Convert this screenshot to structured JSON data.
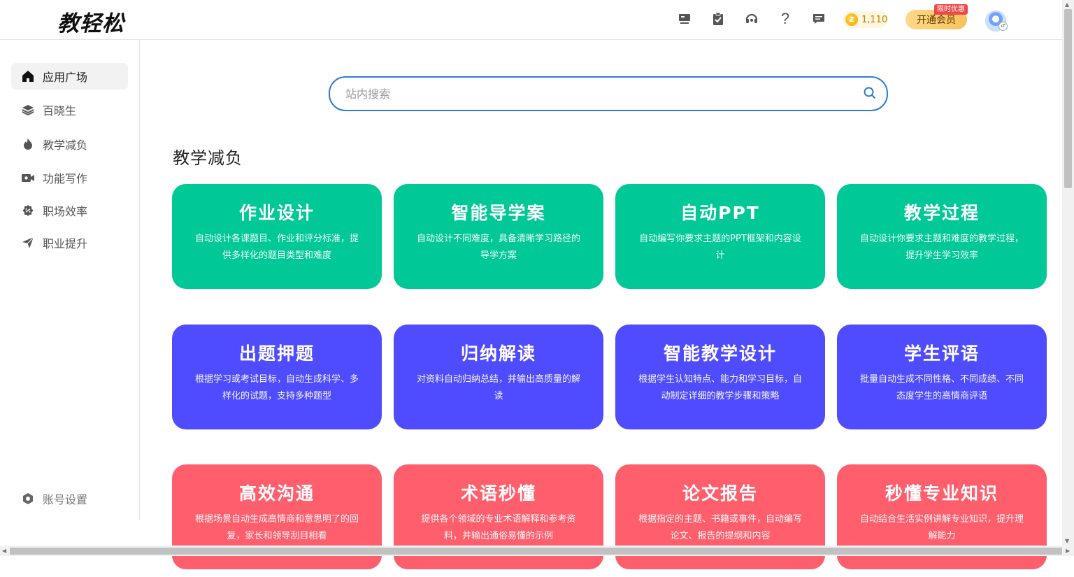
{
  "header": {
    "logo": "教轻松",
    "coin_count": "1,110",
    "vip_label": "开通会员",
    "vip_badge": "限时优惠",
    "icons": [
      "monitor-icon",
      "clipboard-icon",
      "headset-icon",
      "help-icon",
      "message-icon"
    ]
  },
  "sidebar": {
    "items": [
      {
        "label": "应用广场",
        "icon": "home-icon",
        "active": true
      },
      {
        "label": "百晓生",
        "icon": "layers-icon"
      },
      {
        "label": "教学减负",
        "icon": "fire-icon"
      },
      {
        "label": "功能写作",
        "icon": "camera-icon"
      },
      {
        "label": "职场效率",
        "icon": "badge-icon"
      },
      {
        "label": "职业提升",
        "icon": "send-icon"
      }
    ],
    "settings_label": "账号设置"
  },
  "search": {
    "placeholder": "站内搜索"
  },
  "section": {
    "title": "教学减负"
  },
  "cards": [
    {
      "title": "作业设计",
      "desc": "自动设计各课题目、作业和评分标准，提供多样化的题目类型和难度",
      "color": "#00c896"
    },
    {
      "title": "智能导学案",
      "desc": "自动设计不同难度，具备清晰学习路径的导学方案",
      "color": "#00c896"
    },
    {
      "title": "自动PPT",
      "desc": "自动编写你要求主题的PPT框架和内容设计",
      "color": "#00c896"
    },
    {
      "title": "教学过程",
      "desc": "自动设计你要求主题和难度的教学过程，提升学生学习效率",
      "color": "#00c896"
    },
    {
      "title": "出题押题",
      "desc": "根据学习或考试目标，自动生成科学、多样化的试题，支持多种题型",
      "color": "#4f4cff"
    },
    {
      "title": "归纳解读",
      "desc": "对资料自动归纳总结，并输出高质量的解读",
      "color": "#4f4cff"
    },
    {
      "title": "智能教学设计",
      "desc": "根据学生认知特点、能力和学习目标，自动制定详细的教学步骤和策略",
      "color": "#4f4cff"
    },
    {
      "title": "学生评语",
      "desc": "批量自动生成不同性格、不同成绩、不同态度学生的高情商评语",
      "color": "#4f4cff"
    },
    {
      "title": "高效沟通",
      "desc": "根据场景自动生成高情商和意思明了的回复，家长和领导刮目相看",
      "color": "#ff5e6c"
    },
    {
      "title": "术语秒懂",
      "desc": "提供各个领域的专业术语解释和参考资料，并输出通俗易懂的示例",
      "color": "#ff5e6c"
    },
    {
      "title": "论文报告",
      "desc": "根据指定的主题、书籍或事件，自动编写论文、报告的提纲和内容",
      "color": "#ff5e6c"
    },
    {
      "title": "秒懂专业知识",
      "desc": "自动结合生活实例讲解专业知识，提升理解能力",
      "color": "#ff5e6c"
    }
  ]
}
